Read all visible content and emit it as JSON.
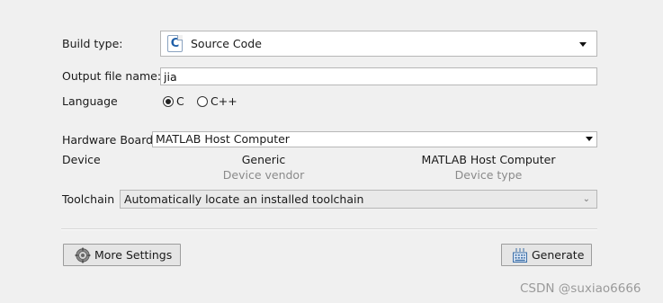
{
  "build_type": {
    "label": "Build type:",
    "value": "Source Code",
    "icon": "c-source-file-icon"
  },
  "output_file": {
    "label": "Output file name:",
    "value": "jia"
  },
  "language": {
    "label": "Language",
    "options": [
      {
        "label": "C",
        "selected": true
      },
      {
        "label": "C++",
        "selected": false
      }
    ]
  },
  "hardware": {
    "board_label": "Hardware Board",
    "board_value": "MATLAB Host Computer",
    "device_label": "Device",
    "vendor_value": "Generic",
    "vendor_caption": "Device vendor",
    "type_value": "MATLAB Host Computer",
    "type_caption": "Device type"
  },
  "toolchain": {
    "label": "Toolchain",
    "value": "Automatically locate an installed toolchain"
  },
  "buttons": {
    "more_settings": "More Settings",
    "generate": "Generate"
  },
  "watermark": "CSDN @suxiao6666"
}
